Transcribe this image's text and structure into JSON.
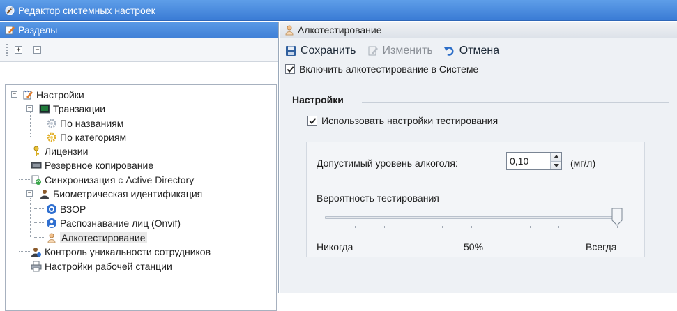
{
  "window": {
    "title": "Редактор системных настроек"
  },
  "left_panel": {
    "header": "Разделы",
    "expand_all": "+",
    "collapse_all": "−",
    "tree": [
      {
        "label": "Настройки",
        "expanded": true
      },
      {
        "label": "Транзакции",
        "expanded": true
      },
      {
        "label": "По названиям"
      },
      {
        "label": "По категориям"
      },
      {
        "label": "Лицензии"
      },
      {
        "label": "Резервное копирование"
      },
      {
        "label": "Синхронизация с Active Directory"
      },
      {
        "label": "Биометрическая идентификация",
        "expanded": true
      },
      {
        "label": "ВЗОР"
      },
      {
        "label": "Распознавание лиц (Onvif)"
      },
      {
        "label": "Алкотестирование",
        "selected": true
      },
      {
        "label": "Контроль уникальности сотрудников"
      },
      {
        "label": "Настройки рабочей станции"
      }
    ]
  },
  "right_panel": {
    "header": "Алкотестирование",
    "actions": {
      "save": "Сохранить",
      "edit": "Изменить",
      "cancel": "Отмена"
    },
    "enable_label": "Включить алкотестирование в Системе",
    "enable_checked": true,
    "settings_title": "Настройки",
    "use_settings_label": "Использовать настройки тестирования",
    "use_settings_checked": true,
    "level_label": "Допустимый уровень алкоголя:",
    "level_value": "0,10",
    "level_unit": "(мг/л)",
    "probability_label": "Вероятность тестирования",
    "probability_value_percent": 100,
    "slider_min_label": "Никогда",
    "slider_mid_label": "50%",
    "slider_max_label": "Всегда"
  },
  "colors": {
    "title_blue": "#3a7bd5",
    "panel_bg": "#eef1f5"
  }
}
